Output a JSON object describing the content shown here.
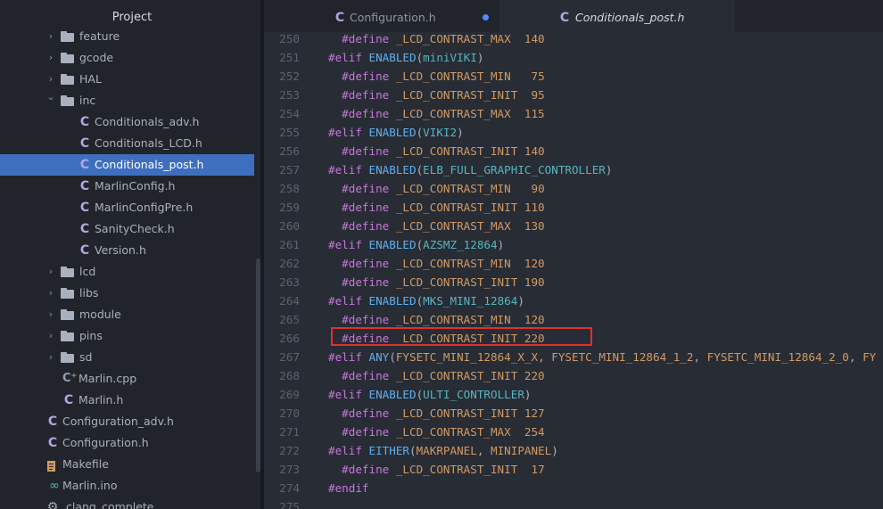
{
  "sidebar": {
    "title": "Project",
    "items": [
      {
        "type": "folder",
        "label": "feature",
        "expanded": false
      },
      {
        "type": "folder",
        "label": "gcode",
        "expanded": false
      },
      {
        "type": "folder",
        "label": "HAL",
        "expanded": false
      },
      {
        "type": "folder",
        "label": "inc",
        "expanded": true
      },
      {
        "type": "c-file",
        "label": "Conditionals_adv.h"
      },
      {
        "type": "c-file",
        "label": "Conditionals_LCD.h"
      },
      {
        "type": "c-file",
        "label": "Conditionals_post.h",
        "selected": true
      },
      {
        "type": "c-file",
        "label": "MarlinConfig.h"
      },
      {
        "type": "c-file",
        "label": "MarlinConfigPre.h"
      },
      {
        "type": "c-file",
        "label": "SanityCheck.h"
      },
      {
        "type": "c-file",
        "label": "Version.h"
      },
      {
        "type": "folder",
        "label": "lcd",
        "expanded": false
      },
      {
        "type": "folder",
        "label": "libs",
        "expanded": false
      },
      {
        "type": "folder",
        "label": "module",
        "expanded": false
      },
      {
        "type": "folder",
        "label": "pins",
        "expanded": false
      },
      {
        "type": "folder",
        "label": "sd",
        "expanded": false
      },
      {
        "type": "cpp-file",
        "label": "Marlin.cpp"
      },
      {
        "type": "c-file",
        "label": "Marlin.h"
      },
      {
        "type": "c-file",
        "label": "Configuration_adv.h"
      },
      {
        "type": "c-file",
        "label": "Configuration.h"
      },
      {
        "type": "text-file",
        "label": "Makefile"
      },
      {
        "type": "ino-file",
        "label": "Marlin.ino"
      },
      {
        "type": "config-file",
        "label": ".clang_complete"
      }
    ]
  },
  "tabs": [
    {
      "label": "Configuration.h",
      "active": false,
      "modified": true
    },
    {
      "label": "Conditionals_post.h",
      "active": true,
      "modified": false
    }
  ],
  "editor": {
    "lines": [
      {
        "n": "250",
        "t": [
          [
            "kw",
            "  #define "
          ],
          [
            "mc",
            "_LCD_CONTRAST_MAX  "
          ],
          [
            "num",
            "140"
          ]
        ]
      },
      {
        "n": "251",
        "t": [
          [
            "kw",
            "#elif "
          ],
          [
            "fn",
            "ENABLED"
          ],
          [
            "plain",
            "("
          ],
          [
            "id",
            "miniVIKI"
          ],
          [
            "plain",
            ")"
          ]
        ]
      },
      {
        "n": "252",
        "t": [
          [
            "kw",
            "  #define "
          ],
          [
            "mc",
            "_LCD_CONTRAST_MIN   "
          ],
          [
            "num",
            "75"
          ]
        ]
      },
      {
        "n": "253",
        "t": [
          [
            "kw",
            "  #define "
          ],
          [
            "mc",
            "_LCD_CONTRAST_INIT  "
          ],
          [
            "num",
            "95"
          ]
        ]
      },
      {
        "n": "254",
        "t": [
          [
            "kw",
            "  #define "
          ],
          [
            "mc",
            "_LCD_CONTRAST_MAX  "
          ],
          [
            "num",
            "115"
          ]
        ]
      },
      {
        "n": "255",
        "t": [
          [
            "kw",
            "#elif "
          ],
          [
            "fn",
            "ENABLED"
          ],
          [
            "plain",
            "("
          ],
          [
            "id",
            "VIKI2"
          ],
          [
            "plain",
            ")"
          ]
        ]
      },
      {
        "n": "256",
        "t": [
          [
            "kw",
            "  #define "
          ],
          [
            "mc",
            "_LCD_CONTRAST_INIT "
          ],
          [
            "num",
            "140"
          ]
        ]
      },
      {
        "n": "257",
        "t": [
          [
            "kw",
            "#elif "
          ],
          [
            "fn",
            "ENABLED"
          ],
          [
            "plain",
            "("
          ],
          [
            "id",
            "ELB_FULL_GRAPHIC_CONTROLLER"
          ],
          [
            "plain",
            ")"
          ]
        ]
      },
      {
        "n": "258",
        "t": [
          [
            "kw",
            "  #define "
          ],
          [
            "mc",
            "_LCD_CONTRAST_MIN   "
          ],
          [
            "num",
            "90"
          ]
        ]
      },
      {
        "n": "259",
        "t": [
          [
            "kw",
            "  #define "
          ],
          [
            "mc",
            "_LCD_CONTRAST_INIT "
          ],
          [
            "num",
            "110"
          ]
        ]
      },
      {
        "n": "260",
        "t": [
          [
            "kw",
            "  #define "
          ],
          [
            "mc",
            "_LCD_CONTRAST_MAX  "
          ],
          [
            "num",
            "130"
          ]
        ]
      },
      {
        "n": "261",
        "t": [
          [
            "kw",
            "#elif "
          ],
          [
            "fn",
            "ENABLED"
          ],
          [
            "plain",
            "("
          ],
          [
            "id",
            "AZSMZ_12864"
          ],
          [
            "plain",
            ")"
          ]
        ]
      },
      {
        "n": "262",
        "t": [
          [
            "kw",
            "  #define "
          ],
          [
            "mc",
            "_LCD_CONTRAST_MIN  "
          ],
          [
            "num",
            "120"
          ]
        ]
      },
      {
        "n": "263",
        "t": [
          [
            "kw",
            "  #define "
          ],
          [
            "mc",
            "_LCD_CONTRAST_INIT "
          ],
          [
            "num",
            "190"
          ]
        ]
      },
      {
        "n": "264",
        "t": [
          [
            "kw",
            "#elif "
          ],
          [
            "fn",
            "ENABLED"
          ],
          [
            "plain",
            "("
          ],
          [
            "id",
            "MKS_MINI_12864"
          ],
          [
            "plain",
            ")"
          ]
        ]
      },
      {
        "n": "265",
        "t": [
          [
            "kw",
            "  #define "
          ],
          [
            "mc",
            "_LCD_CONTRAST_MIN  "
          ],
          [
            "num",
            "120"
          ]
        ]
      },
      {
        "n": "266",
        "t": [
          [
            "kw",
            "  #define "
          ],
          [
            "mc",
            "_LCD_CONTRAST_INIT "
          ],
          [
            "num",
            "220"
          ]
        ]
      },
      {
        "n": "267",
        "t": [
          [
            "kw",
            "#elif "
          ],
          [
            "fn",
            "ANY"
          ],
          [
            "plain",
            "("
          ],
          [
            "mc",
            "FYSETC_MINI_12864_X_X"
          ],
          [
            "plain",
            ", "
          ],
          [
            "mc",
            "FYSETC_MINI_12864_1_2"
          ],
          [
            "plain",
            ", "
          ],
          [
            "mc",
            "FYSETC_MINI_12864_2_0"
          ],
          [
            "plain",
            ", "
          ],
          [
            "mc",
            "FY"
          ]
        ]
      },
      {
        "n": "268",
        "t": [
          [
            "kw",
            "  #define "
          ],
          [
            "mc",
            "_LCD_CONTRAST_INIT "
          ],
          [
            "num",
            "220"
          ]
        ]
      },
      {
        "n": "269",
        "t": [
          [
            "kw",
            "#elif "
          ],
          [
            "fn",
            "ENABLED"
          ],
          [
            "plain",
            "("
          ],
          [
            "id",
            "ULTI_CONTROLLER"
          ],
          [
            "plain",
            ")"
          ]
        ]
      },
      {
        "n": "270",
        "t": [
          [
            "kw",
            "  #define "
          ],
          [
            "mc",
            "_LCD_CONTRAST_INIT "
          ],
          [
            "num",
            "127"
          ]
        ]
      },
      {
        "n": "271",
        "t": [
          [
            "kw",
            "  #define "
          ],
          [
            "mc",
            "_LCD_CONTRAST_MAX  "
          ],
          [
            "num",
            "254"
          ]
        ]
      },
      {
        "n": "272",
        "t": [
          [
            "kw",
            "#elif "
          ],
          [
            "fn",
            "EITHER"
          ],
          [
            "plain",
            "("
          ],
          [
            "mc",
            "MAKRPANEL"
          ],
          [
            "plain",
            ", "
          ],
          [
            "mc",
            "MINIPANEL"
          ],
          [
            "plain",
            ")"
          ]
        ]
      },
      {
        "n": "273",
        "t": [
          [
            "kw",
            "  #define "
          ],
          [
            "mc",
            "_LCD_CONTRAST_INIT  "
          ],
          [
            "num",
            "17"
          ]
        ]
      },
      {
        "n": "274",
        "t": [
          [
            "kw",
            "#endif"
          ]
        ]
      },
      {
        "n": "275",
        "t": []
      }
    ]
  },
  "colors": {
    "selection": "#3e6fbf",
    "highlight_box": "#e03030",
    "keyword": "#c678dd",
    "function": "#61afef",
    "macro": "#d19a66",
    "identifier": "#56b6c2"
  }
}
